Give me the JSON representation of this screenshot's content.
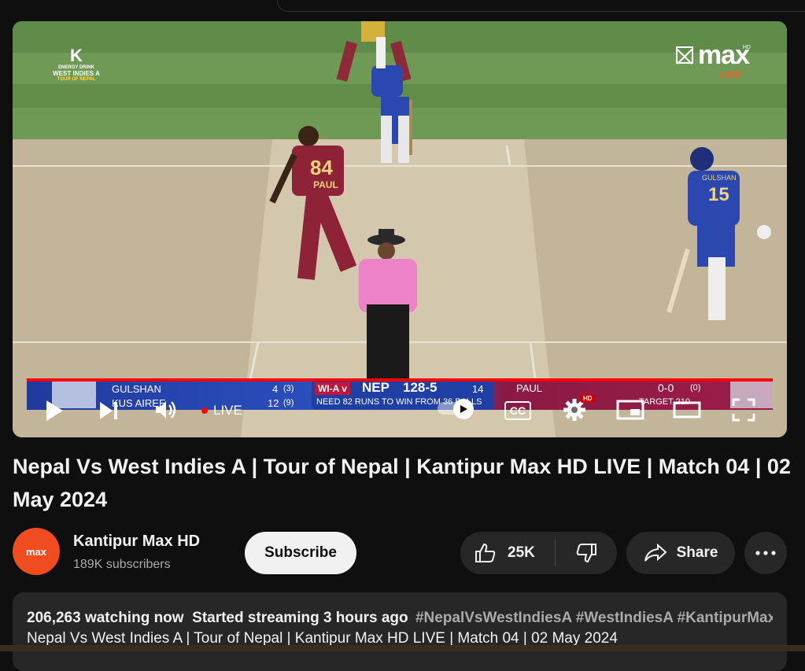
{
  "video": {
    "channel_logo_text": "max",
    "channel_logo_live": "LIVE",
    "channel_logo_hd": "HD",
    "event_logo_mark": "K",
    "event_logo_brand": "ENERGY DRINK",
    "event_logo_title": "WEST INDIES A",
    "event_logo_sub": "TOUR OF NEPAL",
    "player_jersey_1": "84",
    "player_name_1": "PAUL",
    "player_jersey_2": "15",
    "player_name_2": "GULSHAN"
  },
  "scorebar": {
    "batter1_name": "GULSHAN",
    "batter1_score": "4",
    "batter1_balls": "(3)",
    "batter2_name": "KUS AIREE",
    "batter2_score": "12",
    "batter2_balls": "(9)",
    "match_label": "WI-A v",
    "team": "NEP",
    "score": "128-5",
    "overs": "14",
    "need_text": "NEED 82 RUNS TO WIN FROM 36 BALLS",
    "bowler_name": "PAUL",
    "bowler_figures": "0-0",
    "bowler_overs": "(0)",
    "target_text": "TARGET 210"
  },
  "controls": {
    "live_label": "LIVE",
    "cc_label": "CC",
    "hd_badge": "HD",
    "progress_percent": 100
  },
  "title": "Nepal Vs West Indies A | Tour of Nepal | Kantipur Max HD LIVE | Match 04 | 02 May 2024",
  "channel": {
    "avatar_text": "max",
    "name": "Kantipur Max HD",
    "subscribers": "189K subscribers",
    "subscribe_label": "Subscribe"
  },
  "actions": {
    "likes": "25K",
    "share_label": "Share"
  },
  "description": {
    "watching": "206,263 watching now",
    "started": "Started streaming 3 hours ago",
    "hashtags": "#NepalVsWestIndiesA #WestIndiesA #KantipurMaxHD",
    "line2": "Nepal Vs West Indies A | Tour of Nepal | Kantipur Max HD LIVE | Match 04 | 02 May 2024"
  },
  "colors": {
    "background": "#0f0f0f",
    "pill": "#272727",
    "accent_red": "#ff0000",
    "brand_orange": "#f04c1f"
  }
}
